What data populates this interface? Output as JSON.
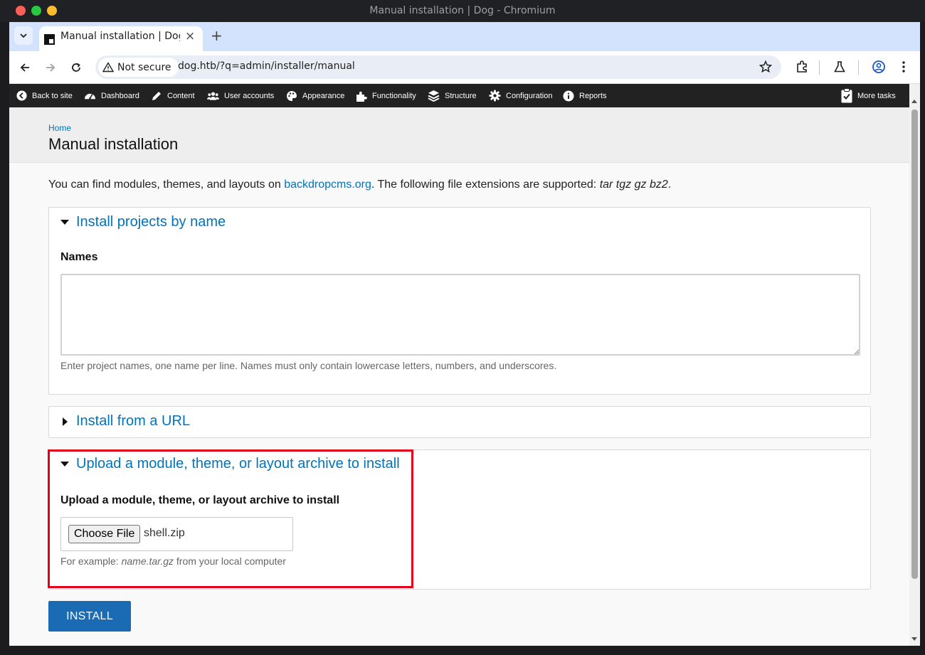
{
  "window": {
    "title": "Manual installation | Dog - Chromium"
  },
  "tab": {
    "title": "Manual installation | Dog",
    "close": "×",
    "new_tab": "+"
  },
  "toolbar": {
    "security_label": "Not secure",
    "url": "dog.htb/?q=admin/installer/manual"
  },
  "adminbar": {
    "items": [
      {
        "label": "Back to site",
        "icon": "arrow-left-circle-icon"
      },
      {
        "label": "Dashboard",
        "icon": "dashboard-gauge-icon"
      },
      {
        "label": "Content",
        "icon": "pencil-icon"
      },
      {
        "label": "User accounts",
        "icon": "users-icon"
      },
      {
        "label": "Appearance",
        "icon": "palette-icon"
      },
      {
        "label": "Functionality",
        "icon": "puzzle-icon"
      },
      {
        "label": "Structure",
        "icon": "layers-icon"
      },
      {
        "label": "Configuration",
        "icon": "gear-icon"
      },
      {
        "label": "Reports",
        "icon": "info-icon"
      }
    ],
    "more_tasks": "More tasks"
  },
  "page": {
    "breadcrumb": "Home",
    "title": "Manual installation",
    "intro_prefix": "You can find modules, themes, and layouts on ",
    "intro_link": "backdropcms.org",
    "intro_middle": ". The following file extensions are supported: ",
    "intro_extensions": "tar tgz gz bz2",
    "intro_suffix": "."
  },
  "sections": {
    "by_name": {
      "legend": "Install projects by name",
      "field_label": "Names",
      "value": "",
      "description": "Enter project names, one name per line. Names must only contain lowercase letters, numbers, and underscores."
    },
    "from_url": {
      "legend": "Install from a URL"
    },
    "upload": {
      "legend": "Upload a module, theme, or layout archive to install",
      "field_label": "Upload a module, theme, or layout archive to install",
      "choose_button": "Choose File",
      "file_name": "shell.zip",
      "description_prefix": "For example: ",
      "description_example": "name.tar.gz",
      "description_suffix": " from your local computer"
    }
  },
  "install_button": "INSTALL",
  "colors": {
    "link": "#0074bd",
    "button": "#1a6bb3",
    "highlight": "#e3001b",
    "adminbar": "#222222"
  }
}
